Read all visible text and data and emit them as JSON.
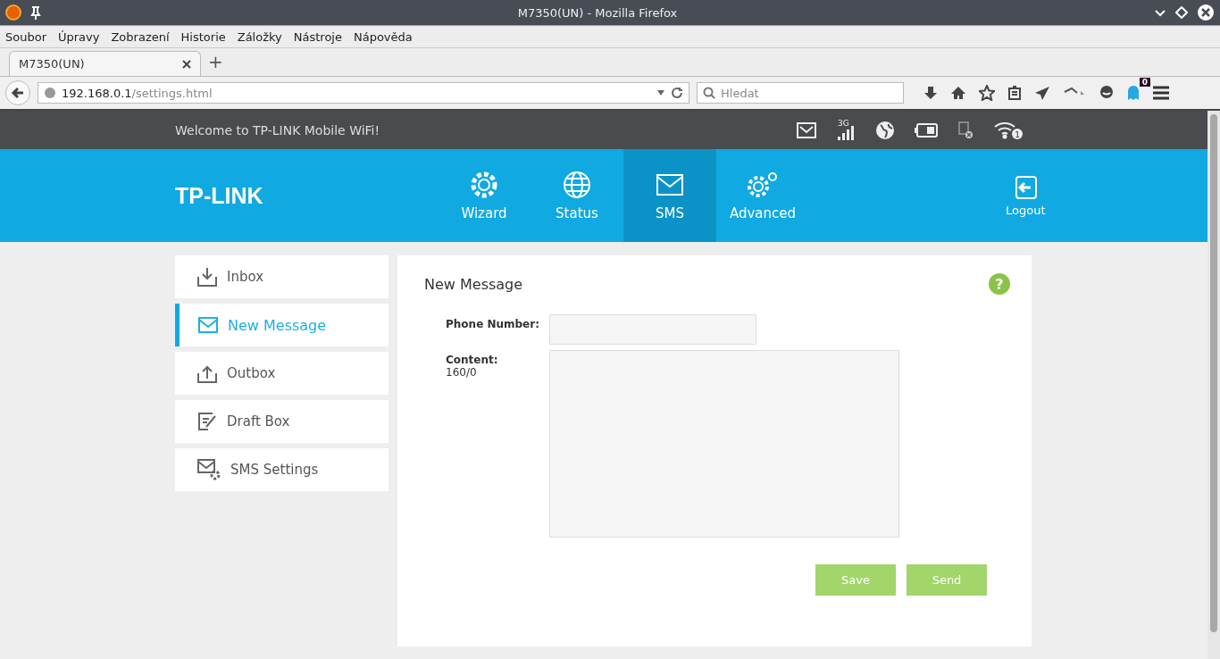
{
  "window": {
    "title": "M7350(UN) - Mozilla Firefox"
  },
  "menu": [
    "Soubor",
    "Úpravy",
    "Zobrazení",
    "Historie",
    "Záložky",
    "Nástroje",
    "Nápověda"
  ],
  "tabs": [
    {
      "label": "M7350(UN)",
      "selected": true
    }
  ],
  "new_tab": "+",
  "address": {
    "host": "192.168.0.1",
    "path": "/settings.html"
  },
  "search": {
    "placeholder": "Hledat"
  },
  "toolbar_badge": "0",
  "page": {
    "welcome": "Welcome to TP-LINK Mobile WiFi!",
    "network_type": "3G",
    "wifi_clients": "1",
    "logo": "TP-LINK",
    "nav": [
      {
        "label": "Wizard",
        "kind": "gear",
        "selected": false
      },
      {
        "label": "Status",
        "kind": "globe",
        "selected": false
      },
      {
        "label": "SMS",
        "kind": "mail",
        "selected": true
      },
      {
        "label": "Advanced",
        "kind": "gears",
        "selected": false
      }
    ],
    "logout": "Logout",
    "sidebar": [
      {
        "label": "Inbox",
        "kind": "inbox",
        "selected": false
      },
      {
        "label": "New Message",
        "kind": "mail",
        "selected": true
      },
      {
        "label": "Outbox",
        "kind": "outbox",
        "selected": false
      },
      {
        "label": "Draft Box",
        "kind": "draft",
        "selected": false
      },
      {
        "label": "SMS Settings",
        "kind": "settings",
        "selected": false
      }
    ],
    "form": {
      "title": "New Message",
      "help": "?",
      "phone_label": "Phone Number:",
      "content_label": "Content:",
      "counter": "160/0",
      "buttons": [
        "Save",
        "Send"
      ]
    }
  }
}
